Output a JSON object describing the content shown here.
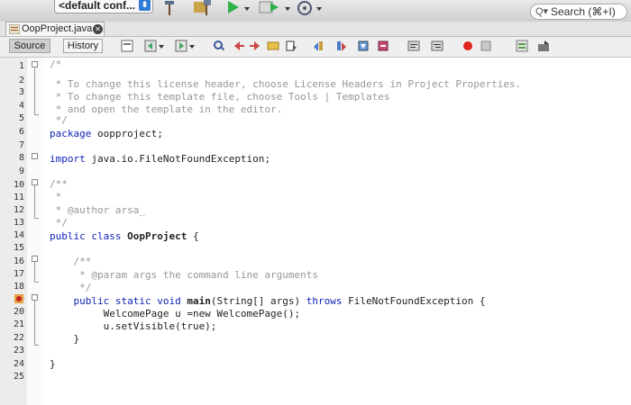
{
  "toolbar": {
    "config_label": "<default conf...",
    "config_dropdown_glyph": "⬍",
    "search_placeholder": "Search (⌘+I)",
    "search_glyph": "Q▾",
    "icons": [
      "hammer-icon",
      "broom-hammer-icon",
      "run-icon",
      "debug-icon",
      "profile-icon"
    ]
  },
  "editor_tab": {
    "filename": "OopProject.java",
    "close_glyph": "✕"
  },
  "editor_toolbar": {
    "source_label": "Source",
    "history_label": "History"
  },
  "line_numbers": [
    "1",
    "2",
    "3",
    "4",
    "5",
    "6",
    "7",
    "8",
    "9",
    "10",
    "11",
    "12",
    "13",
    "14",
    "15",
    "16",
    "17",
    "18",
    "19",
    "20",
    "21",
    "22",
    "23",
    "24",
    "25"
  ],
  "code": {
    "l1": "/*",
    "l2": " * To change this license header, choose License Headers in Project Properties.",
    "l3": " * To change this template file, choose Tools | Templates",
    "l4": " * and open the template in the editor.",
    "l5": " */",
    "l6_kw": "package",
    "l6_rest": " oopproject;",
    "l8_kw": "import",
    "l8_rest": " java.io.FileNotFoundException;",
    "l10": "/**",
    "l11": " *",
    "l12": " * @author arsa_",
    "l13": " */",
    "l14_kw": "public class",
    "l14_name": " OopProject",
    "l14_rest": " {",
    "l16": "    /**",
    "l17": "     * @param args the command line arguments",
    "l18": "     */",
    "l19_kw": "    public static void",
    "l19_name": " main",
    "l19_mid": "(String[] args) ",
    "l19_kw2": "throws",
    "l19_rest": " FileNotFoundException {",
    "l20": "         WelcomePage u =new WelcomePage();",
    "l21": "         u.setVisible(true);",
    "l22": "    }",
    "l24": "}"
  }
}
